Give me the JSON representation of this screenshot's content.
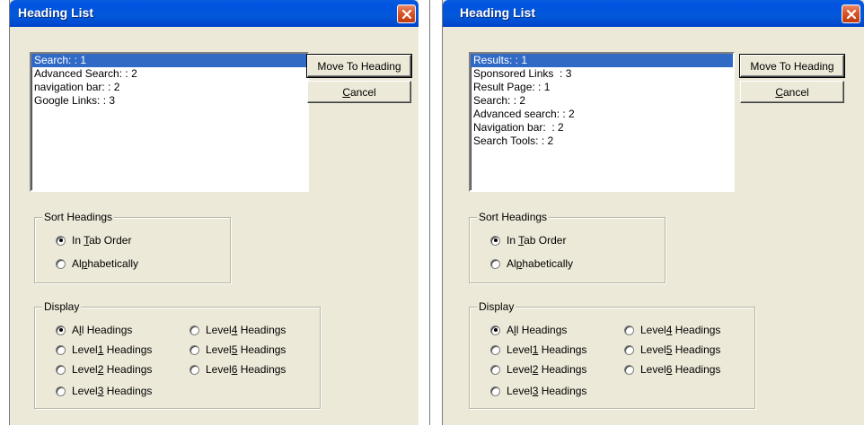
{
  "dialogs": [
    {
      "title": "Heading List",
      "headings": [
        "Search: : 1",
        "Advanced Search: : 2",
        "navigation bar: : 2",
        "Google Links: : 3"
      ],
      "selected_index": 0,
      "buttons": {
        "move_to_heading": "Move To Heading",
        "cancel": "Cancel"
      },
      "sort_headings": {
        "label": "Sort Headings",
        "options": [
          {
            "pre": "In ",
            "key": "T",
            "post": "ab Order",
            "checked": true
          },
          {
            "pre": "Al",
            "key": "p",
            "post": "habetically",
            "checked": false
          }
        ]
      },
      "display": {
        "label": "Display",
        "options": [
          {
            "pre": "A",
            "key": "l",
            "post": "l Headings",
            "checked": true
          },
          {
            "pre": "Level",
            "key": "1",
            "post": " Headings",
            "checked": false
          },
          {
            "pre": "Level",
            "key": "2",
            "post": " Headings",
            "checked": false
          },
          {
            "pre": "Level",
            "key": "3",
            "post": " Headings",
            "checked": false
          },
          {
            "pre": "Level",
            "key": "4",
            "post": " Headings",
            "checked": false
          },
          {
            "pre": "Level",
            "key": "5",
            "post": " Headings",
            "checked": false
          },
          {
            "pre": "Level",
            "key": "6",
            "post": " Headings",
            "checked": false
          }
        ]
      }
    },
    {
      "title": "Heading List",
      "headings": [
        "Results: : 1",
        "Sponsored Links  : 3",
        "Result Page: : 1",
        "Search: : 2",
        "Advanced search: : 2",
        "Navigation bar:  : 2",
        "Search Tools: : 2"
      ],
      "selected_index": 0,
      "buttons": {
        "move_to_heading": "Move To Heading",
        "cancel": "Cancel"
      },
      "sort_headings": {
        "label": "Sort Headings",
        "options": [
          {
            "pre": "In ",
            "key": "T",
            "post": "ab Order",
            "checked": true
          },
          {
            "pre": "Al",
            "key": "p",
            "post": "habetically",
            "checked": false
          }
        ]
      },
      "display": {
        "label": "Display",
        "options": [
          {
            "pre": "A",
            "key": "l",
            "post": "l Headings",
            "checked": true
          },
          {
            "pre": "Level",
            "key": "1",
            "post": " Headings",
            "checked": false
          },
          {
            "pre": "Level",
            "key": "2",
            "post": " Headings",
            "checked": false
          },
          {
            "pre": "Level",
            "key": "3",
            "post": " Headings",
            "checked": false
          },
          {
            "pre": "Level",
            "key": "4",
            "post": " Headings",
            "checked": false
          },
          {
            "pre": "Level",
            "key": "5",
            "post": " Headings",
            "checked": false
          },
          {
            "pre": "Level",
            "key": "6",
            "post": " Headings",
            "checked": false
          }
        ]
      }
    }
  ],
  "colors": {
    "title_bar": "#0054e3",
    "selection": "#316ac5",
    "close_button": "#d9562a",
    "dialog_face": "#ece9d8"
  },
  "icons": {
    "close": "close-icon",
    "radio": "radio-button"
  }
}
